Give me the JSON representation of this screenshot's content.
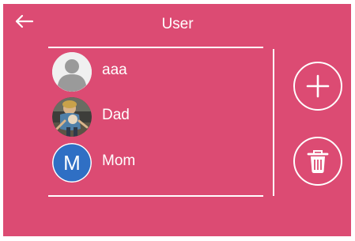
{
  "header": {
    "title": "User",
    "back_icon": "arrow-left-icon"
  },
  "users": [
    {
      "name": "aaa",
      "avatar": "default-person-icon"
    },
    {
      "name": "Dad",
      "avatar": "photo"
    },
    {
      "name": "Mom",
      "avatar": "letter",
      "avatar_letter": "M",
      "avatar_color": "#2f6fc4"
    }
  ],
  "actions": {
    "add_icon": "plus-icon",
    "delete_icon": "trash-icon"
  },
  "colors": {
    "background": "#dc4b73",
    "foreground": "#ffffff"
  }
}
